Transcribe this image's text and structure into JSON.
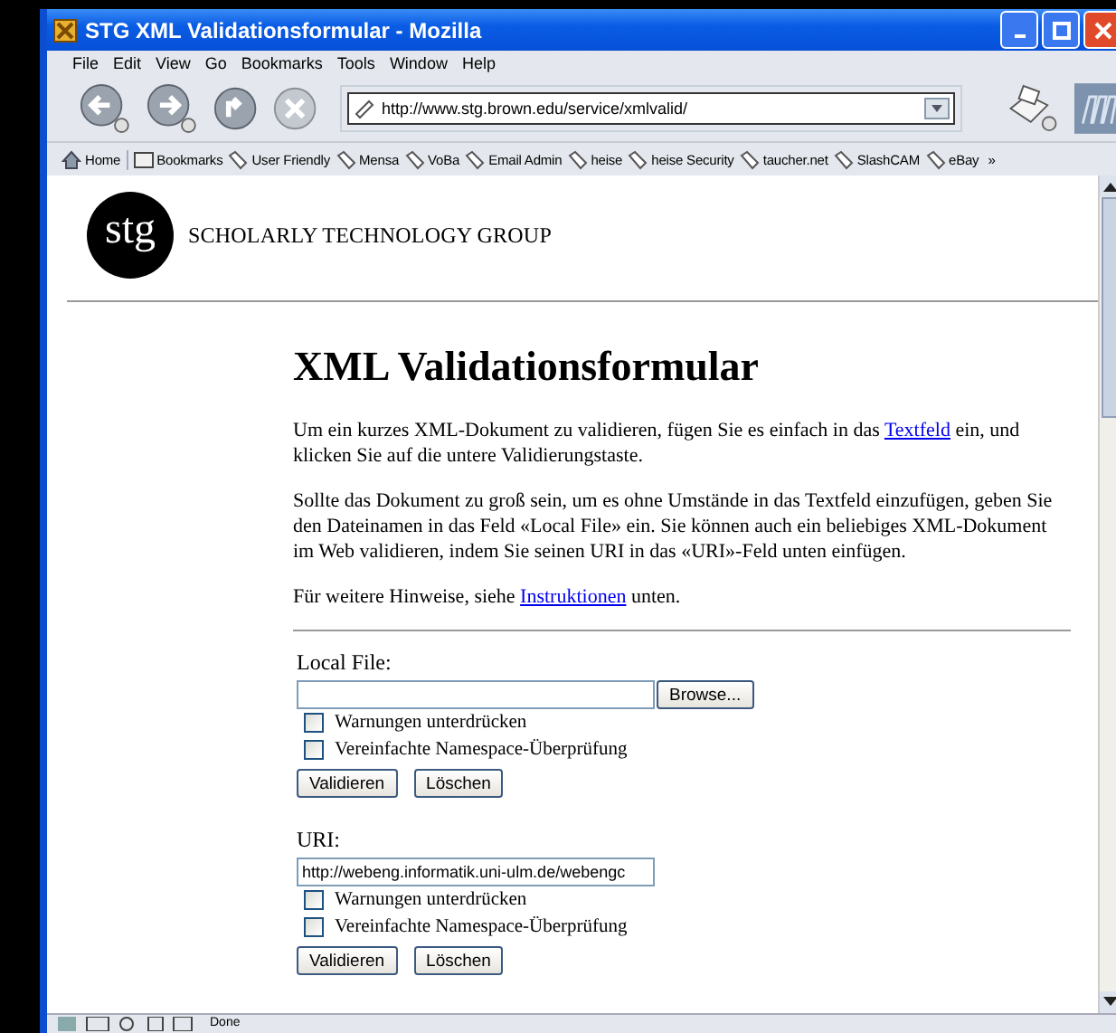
{
  "window": {
    "title": "STG XML Validationsformular - Mozilla"
  },
  "menu": [
    "File",
    "Edit",
    "View",
    "Go",
    "Bookmarks",
    "Tools",
    "Window",
    "Help"
  ],
  "address": {
    "value": "http://www.stg.brown.edu/service/xmlvalid/"
  },
  "bookmarks": [
    {
      "label": "Home",
      "kind": "home"
    },
    {
      "label": "Bookmarks",
      "kind": "folder"
    },
    {
      "label": "User Friendly",
      "kind": "link"
    },
    {
      "label": "Mensa",
      "kind": "link"
    },
    {
      "label": "VoBa",
      "kind": "link"
    },
    {
      "label": "Email Admin",
      "kind": "link"
    },
    {
      "label": "heise",
      "kind": "link"
    },
    {
      "label": "heise Security",
      "kind": "link"
    },
    {
      "label": "taucher.net",
      "kind": "link"
    },
    {
      "label": "SlashCAM",
      "kind": "link"
    },
    {
      "label": "eBay",
      "kind": "link"
    }
  ],
  "bookmarks_more": "»",
  "logo": {
    "mark": "stg",
    "name": "SCHOLARLY TECHNOLOGY GROUP"
  },
  "heading": "XML Validationsformular",
  "paragraphs": [
    {
      "before": "Um ein kurzes XML-Dokument zu validieren, fügen Sie es einfach in das ",
      "link": "Textfeld",
      "after": " ein, und klicken Sie auf die untere Validierungstaste."
    },
    {
      "before": "Sollte das Dokument zu groß sein, um es ohne Umstände in das Textfeld einzufügen, geben Sie den Dateinamen in das Feld «Local File» ein. Sie können auch ein beliebiges XML-Dokument im Web validieren, indem Sie seinen URI in das «URI»-Feld unten einfügen."
    },
    {
      "before": "Für weitere Hinweise, siehe ",
      "link": "Instruktionen",
      "after": " unten."
    }
  ],
  "forms": [
    {
      "label": "Local File:",
      "kind": "file",
      "browse": "Browse...",
      "options": [
        {
          "label": "Warnungen unterdrücken",
          "checked": false
        },
        {
          "label": "Vereinfachte Namespace-Überprüfung",
          "checked": false
        }
      ],
      "buttons": [
        "Validieren",
        "Löschen"
      ]
    },
    {
      "label": "URI:",
      "kind": "text",
      "value": "http://webeng.informatik.uni-ulm.de/webengc",
      "options": [
        {
          "label": "Warnungen unterdrücken",
          "checked": false
        },
        {
          "label": "Vereinfachte Namespace-Überprüfung",
          "checked": false
        }
      ],
      "buttons": [
        "Validieren",
        "Löschen"
      ]
    }
  ],
  "status_bar": {
    "text": "Done"
  }
}
